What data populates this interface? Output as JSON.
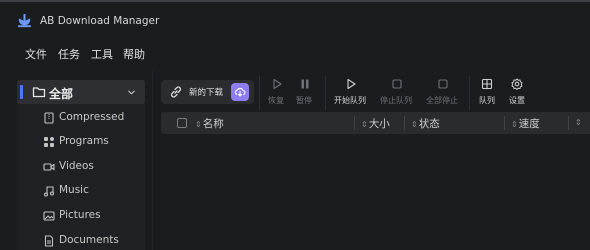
{
  "app": {
    "title": "AB Download Manager",
    "accent_color": "#4a7bf7"
  },
  "menu": {
    "items": [
      {
        "label": "文件"
      },
      {
        "label": "任务"
      },
      {
        "label": "工具"
      },
      {
        "label": "帮助"
      }
    ]
  },
  "sidebar": {
    "header_label": "全部",
    "categories": [
      {
        "label": "Compressed",
        "icon": "archive-icon"
      },
      {
        "label": "Programs",
        "icon": "programs-icon"
      },
      {
        "label": "Videos",
        "icon": "video-icon"
      },
      {
        "label": "Music",
        "icon": "music-icon"
      },
      {
        "label": "Pictures",
        "icon": "picture-icon"
      },
      {
        "label": "Documents",
        "icon": "document-icon"
      }
    ]
  },
  "toolbar": {
    "new_download_label": "新的下载",
    "resume_label": "恢复",
    "pause_label": "暂停",
    "start_queue_label": "开始队列",
    "stop_queue_label": "停止队列",
    "stop_all_label": "全部停止",
    "queues_label": "队列",
    "settings_label": "设置"
  },
  "table": {
    "columns": [
      {
        "label": "名称"
      },
      {
        "label": "大小"
      },
      {
        "label": "状态"
      },
      {
        "label": "速度"
      }
    ]
  }
}
